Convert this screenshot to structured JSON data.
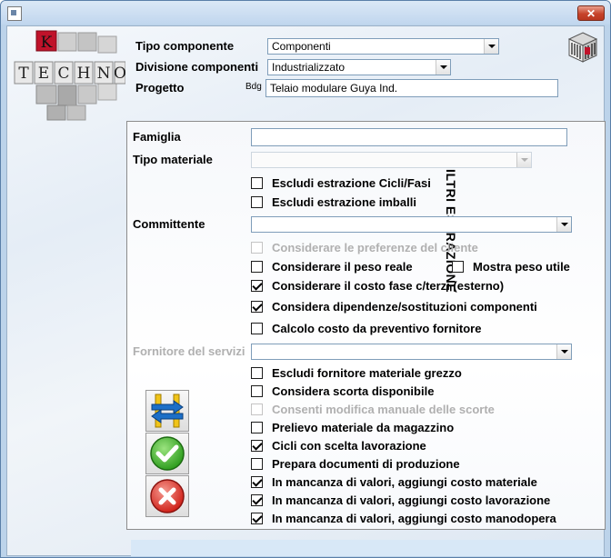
{
  "header": {
    "tipo_componente_label": "Tipo componente",
    "tipo_componente_value": "Componenti",
    "divisione_label": "Divisione componenti",
    "divisione_value": "Industrializzato",
    "progetto_label": "Progetto",
    "progetto_prefix": "Bdg",
    "progetto_value": "Telaio modulare Guya Ind."
  },
  "logo": {
    "letters": [
      "K",
      "T",
      "E",
      "C",
      "H",
      "N",
      "O"
    ]
  },
  "filters": {
    "title": "FILTRI ESTRAZIONE",
    "famiglia_label": "Famiglia",
    "famiglia_value": "",
    "tipo_materiale_label": "Tipo materiale",
    "tipo_materiale_value": "",
    "committente_label": "Committente",
    "committente_value": "",
    "fornitore_label": "Fornitore del servizi",
    "fornitore_value": "",
    "checks": [
      {
        "label": "Escludi estrazione Cicli/Fasi",
        "checked": false,
        "disabled": false
      },
      {
        "label": "Escludi estrazione imballi",
        "checked": false,
        "disabled": false
      },
      {
        "label": "Considerare le preferenze del cliente",
        "checked": false,
        "disabled": true
      },
      {
        "label": "Considerare il peso reale",
        "checked": false,
        "disabled": false
      },
      {
        "label": "Mostra peso utile",
        "checked": false,
        "disabled": false
      },
      {
        "label": "Considerare il costo fase c/terzi (esterno)",
        "checked": true,
        "disabled": false
      },
      {
        "label": "Considera dipendenze/sostituzioni componenti",
        "checked": true,
        "disabled": false
      },
      {
        "label": "Calcolo costo da preventivo fornitore",
        "checked": false,
        "disabled": false
      },
      {
        "label": "Escludi fornitore materiale grezzo",
        "checked": false,
        "disabled": false
      },
      {
        "label": "Considera scorta disponibile",
        "checked": false,
        "disabled": false
      },
      {
        "label": "Consenti modifica manuale delle scorte",
        "checked": false,
        "disabled": true
      },
      {
        "label": "Prelievo materiale da magazzino",
        "checked": false,
        "disabled": false
      },
      {
        "label": "Cicli con scelta lavorazione",
        "checked": true,
        "disabled": false
      },
      {
        "label": "Prepara documenti di produzione",
        "checked": false,
        "disabled": false
      },
      {
        "label": "In mancanza di valori, aggiungi costo materiale",
        "checked": true,
        "disabled": false
      },
      {
        "label": "In mancanza di valori, aggiungi costo lavorazione",
        "checked": true,
        "disabled": false
      },
      {
        "label": "In mancanza di valori, aggiungi costo manodopera",
        "checked": true,
        "disabled": false
      }
    ]
  },
  "icons": {
    "swap": "swap-arrows-icon",
    "confirm": "green-check-icon",
    "cancel": "red-x-icon",
    "barcode": "barcode-cube-icon",
    "close": "close-icon"
  },
  "colors": {
    "green": "#2f9e1f",
    "red": "#d0221a",
    "arrow_blue": "#1c6fc7"
  }
}
